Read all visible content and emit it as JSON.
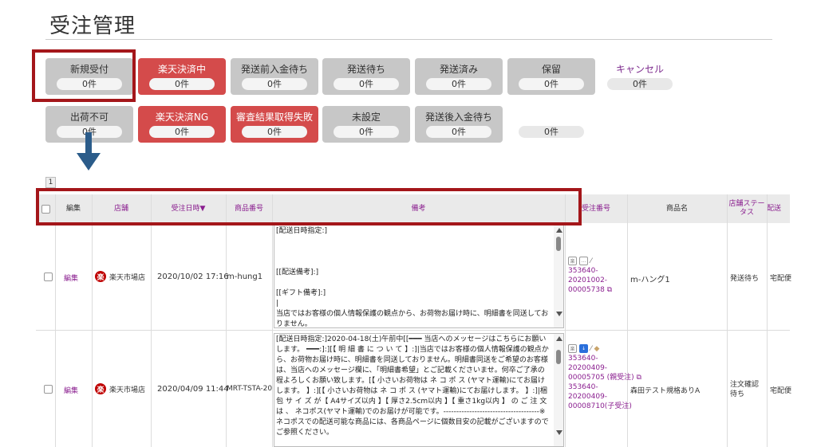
{
  "page": {
    "title": "受注管理"
  },
  "status_tiles": [
    {
      "label": "新規受付",
      "count": "0件",
      "style": "gray"
    },
    {
      "label": "楽天決済中",
      "count": "0件",
      "style": "red"
    },
    {
      "label": "発送前入金待ち",
      "count": "0件",
      "style": "gray"
    },
    {
      "label": "発送待ち",
      "count": "0件",
      "style": "gray"
    },
    {
      "label": "発送済み",
      "count": "0件",
      "style": "gray"
    },
    {
      "label": "保留",
      "count": "0件",
      "style": "gray"
    },
    {
      "label": "キャンセル",
      "count": "0件",
      "style": "plain"
    },
    {
      "label": "出荷不可",
      "count": "0件",
      "style": "gray"
    },
    {
      "label": "楽天決済NG",
      "count": "0件",
      "style": "red"
    },
    {
      "label": "審査結果取得失敗",
      "count": "0件",
      "style": "red"
    },
    {
      "label": "未設定",
      "count": "0件",
      "style": "gray"
    },
    {
      "label": "発送後入金待ち",
      "count": "0件",
      "style": "gray"
    },
    {
      "label": "",
      "count": "0件",
      "style": "plain"
    }
  ],
  "pager": {
    "page": "1"
  },
  "table": {
    "headers": [
      "",
      "編集",
      "店舗",
      "受注日時▼",
      "商品番号",
      "備考",
      "受注番号",
      "商品名",
      "店舗ステータス",
      "配送"
    ],
    "rows": [
      {
        "edit": "編集",
        "shop_logo": "楽",
        "shop": "楽天市場店",
        "date": "2020/10/02 17:16",
        "item_no": "m-hung1",
        "memo": "[配送日時指定:]\n\n\n\n[[配送備考]:]\n\n[[ギフト備考]:]\n|\n当店ではお客様の個人情報保護の観点から、お荷物お届け時に、明細書を同送しておりません。",
        "order_no": "353640-\n20201002-\n00005738 ⧉",
        "product": "m-ハング1",
        "status": "発送待ち",
        "delivery": "宅配便"
      },
      {
        "edit": "編集",
        "shop_logo": "楽",
        "shop": "楽天市場店",
        "date": "2020/04/09 11:44",
        "item_no": "MRT-TSTA-20",
        "memo": "[配送日時指定:]2020-04-18(土)午前中[[━━━ 当店へのメッセージはこちらにお願いします。 ━━━:]:][【 明 細 書 に つ い て 】:]|当店ではお客様の個人情報保護の観点から、お荷物お届け時に、明細書を同送しておりません。明細書同送をご希望のお客様は、当店へのメッセージ欄に、「明細書希望」とご記載くださいませ。何卒ご了承の程よろしくお願い致します。[【 小さいお荷物は ネ コ ポ ス (ヤマト運輸)にてお届けします。 】:][【 小さいお荷物は ネ コ ポ ス (ヤマト運輸)にてお届けします。 】:]|梱 包 サ イ ズ が【 A4サイズ以内 】【 厚さ2.5cm以内 】【 重さ1kg以内 】 の ご 注 文 は 、 ネコポス(ヤマト運輸)でのお届けが可能です。-------------------------------------※ネコポスでの配送可能な商品には、各商品ページに個数目安の記載がございますのでご参照ください。",
        "order_no": "353640-\n20200409-\n00005705 (親受注) ⧉\n353640-\n20200409-\n00008710(子受注)",
        "product": "森田テスト規格ありA",
        "status": "注文確認待ち",
        "delivery": "宅配便"
      }
    ]
  },
  "colors": {
    "accent_red": "#d44b4b",
    "highlight_border": "#a4161a",
    "link_purple": "#8a1e8f",
    "arrow_blue": "#2b5c8a"
  }
}
